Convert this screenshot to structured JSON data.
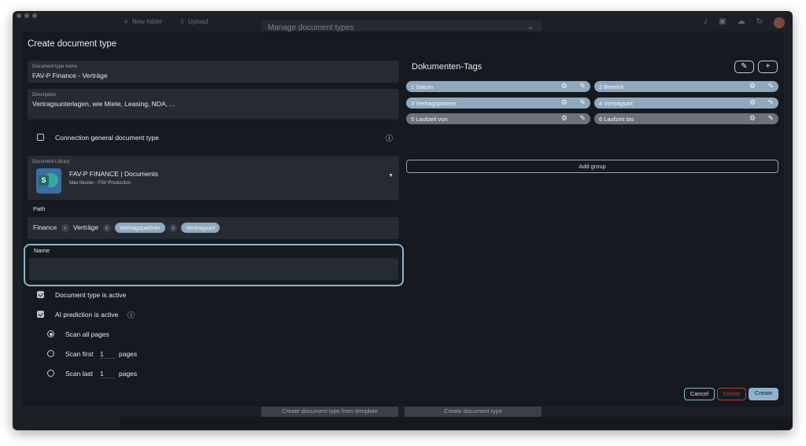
{
  "background": {
    "toolbar": {
      "new_folder": "New folder",
      "upload": "Upload"
    },
    "manage_title": "Manage document types",
    "bottom_buttons": [
      "Create document type from template",
      "Create document type"
    ]
  },
  "modal": {
    "title": "Create document type",
    "doc_type_name": {
      "label": "Document type name",
      "value": "FAV-P Finance - Verträge"
    },
    "description": {
      "label": "Description",
      "value": "Vertragsunterlagen, wie Miete, Leasing, NDA, ..."
    },
    "connection_general": "Connection general document type",
    "library": {
      "label": "Document Library",
      "title": "FAV-P FINANCE | Documents",
      "subtitle": "Max Muster - FAV Production"
    },
    "path": {
      "label": "Path",
      "items": [
        "Finance",
        "Verträge"
      ],
      "chips": [
        "Vertragspartner",
        "Vertragsart"
      ]
    },
    "name": {
      "label": "Name",
      "value": ""
    },
    "document_active": "Document type is active",
    "ai_active": "AI prediction is active",
    "scan_all": "Scan all pages",
    "scan_first": "Scan first",
    "scan_last": "Scan last",
    "scan_first_value": "1",
    "scan_last_value": "1",
    "pages": "pages",
    "tags_title": "Dokumenten-Tags",
    "tags": [
      {
        "label": "1  Datum"
      },
      {
        "label": "2  Bereich"
      },
      {
        "label": "3  Vertragspartner"
      },
      {
        "label": "4  Vertragsart"
      },
      {
        "label": "5  Laufzeit von"
      },
      {
        "label": "6  Laufzeit bis"
      }
    ],
    "add_group": "Add group",
    "cancel": "Cancel",
    "delete": "Delete",
    "create": "Create",
    "colors": {
      "accent": "#8fa8be",
      "focus_border": "#8fb3cf",
      "delete": "#c0392b"
    }
  }
}
